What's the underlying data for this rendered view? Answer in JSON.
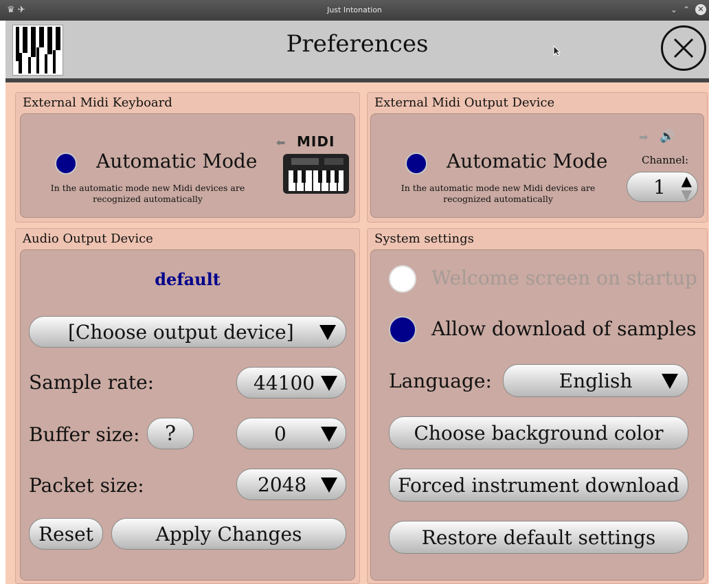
{
  "window": {
    "title": "Just Intonation"
  },
  "header": {
    "title": "Preferences"
  },
  "midi_keyboard": {
    "title": "External Midi Keyboard",
    "mode_label": "Automatic Mode",
    "description": "In the automatic mode new Midi devices are recognized automatically",
    "midi_badge": "MIDI"
  },
  "midi_output": {
    "title": "External Midi Output Device",
    "mode_label": "Automatic Mode",
    "description": "In the automatic mode new Midi devices are recognized automatically",
    "channel_label": "Channel:",
    "channel_value": "1"
  },
  "audio_output": {
    "title": "Audio Output Device",
    "current_device": "default",
    "choose_device": "[Choose output device]",
    "sample_rate_label": "Sample rate:",
    "sample_rate_value": "44100",
    "buffer_size_label": "Buffer size:",
    "buffer_help": "?",
    "buffer_size_value": "0",
    "packet_size_label": "Packet size:",
    "packet_size_value": "2048",
    "reset_label": "Reset",
    "apply_label": "Apply Changes"
  },
  "system": {
    "title": "System settings",
    "welcome_label": "Welcome screen on startup",
    "welcome_checked": false,
    "download_label": "Allow download of samples",
    "download_checked": true,
    "language_label": "Language:",
    "language_value": "English",
    "bg_color_label": "Choose background color",
    "forced_download_label": "Forced instrument download",
    "restore_label": "Restore default settings"
  },
  "colors": {
    "accent": "#00008b",
    "panel": "#eec3b1",
    "inner": "#caaaa2",
    "background": "#f8cdb8"
  }
}
